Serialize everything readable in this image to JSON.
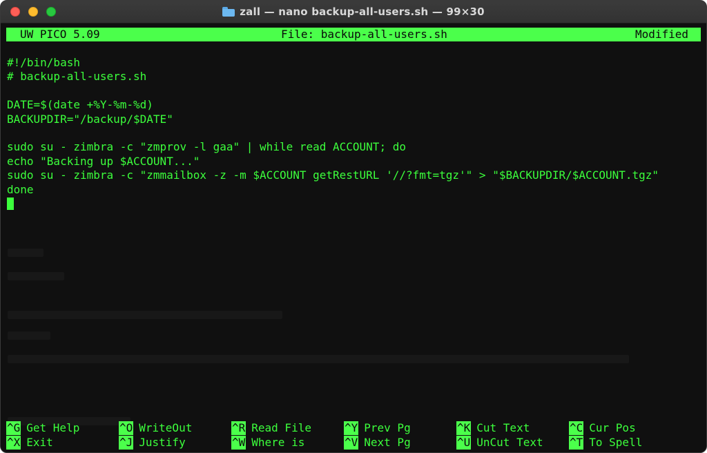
{
  "window": {
    "title": "zall — nano backup-all-users.sh — 99×30"
  },
  "editor_header": {
    "app": "UW PICO 5.09",
    "file": "File: backup-all-users.sh",
    "status": "Modified"
  },
  "code": {
    "lines": [
      "#!/bin/bash",
      "# backup-all-users.sh",
      "",
      "DATE=$(date +%Y-%m-%d)",
      "BACKUPDIR=\"/backup/$DATE\"",
      "",
      "sudo su - zimbra -c \"zmprov -l gaa\" | while read ACCOUNT; do",
      "echo \"Backing up $ACCOUNT...\"",
      "sudo su - zimbra -c \"zmmailbox -z -m $ACCOUNT getRestURL '//?fmt=tgz'\" > \"$BACKUPDIR/$ACCOUNT.tgz\"",
      "done"
    ]
  },
  "shortcuts": {
    "row1": [
      {
        "key": "^G",
        "label": "Get Help"
      },
      {
        "key": "^O",
        "label": "WriteOut"
      },
      {
        "key": "^R",
        "label": "Read File"
      },
      {
        "key": "^Y",
        "label": "Prev Pg"
      },
      {
        "key": "^K",
        "label": "Cut Text"
      },
      {
        "key": "^C",
        "label": "Cur Pos"
      }
    ],
    "row2": [
      {
        "key": "^X",
        "label": "Exit"
      },
      {
        "key": "^J",
        "label": "Justify"
      },
      {
        "key": "^W",
        "label": "Where is"
      },
      {
        "key": "^V",
        "label": "Next Pg"
      },
      {
        "key": "^U",
        "label": "UnCut Text"
      },
      {
        "key": "^T",
        "label": "To Spell"
      }
    ]
  },
  "colors": {
    "terminal_bg": "#101010",
    "terminal_fg": "#3cff3c",
    "highlight_bg": "#4bff4b"
  }
}
